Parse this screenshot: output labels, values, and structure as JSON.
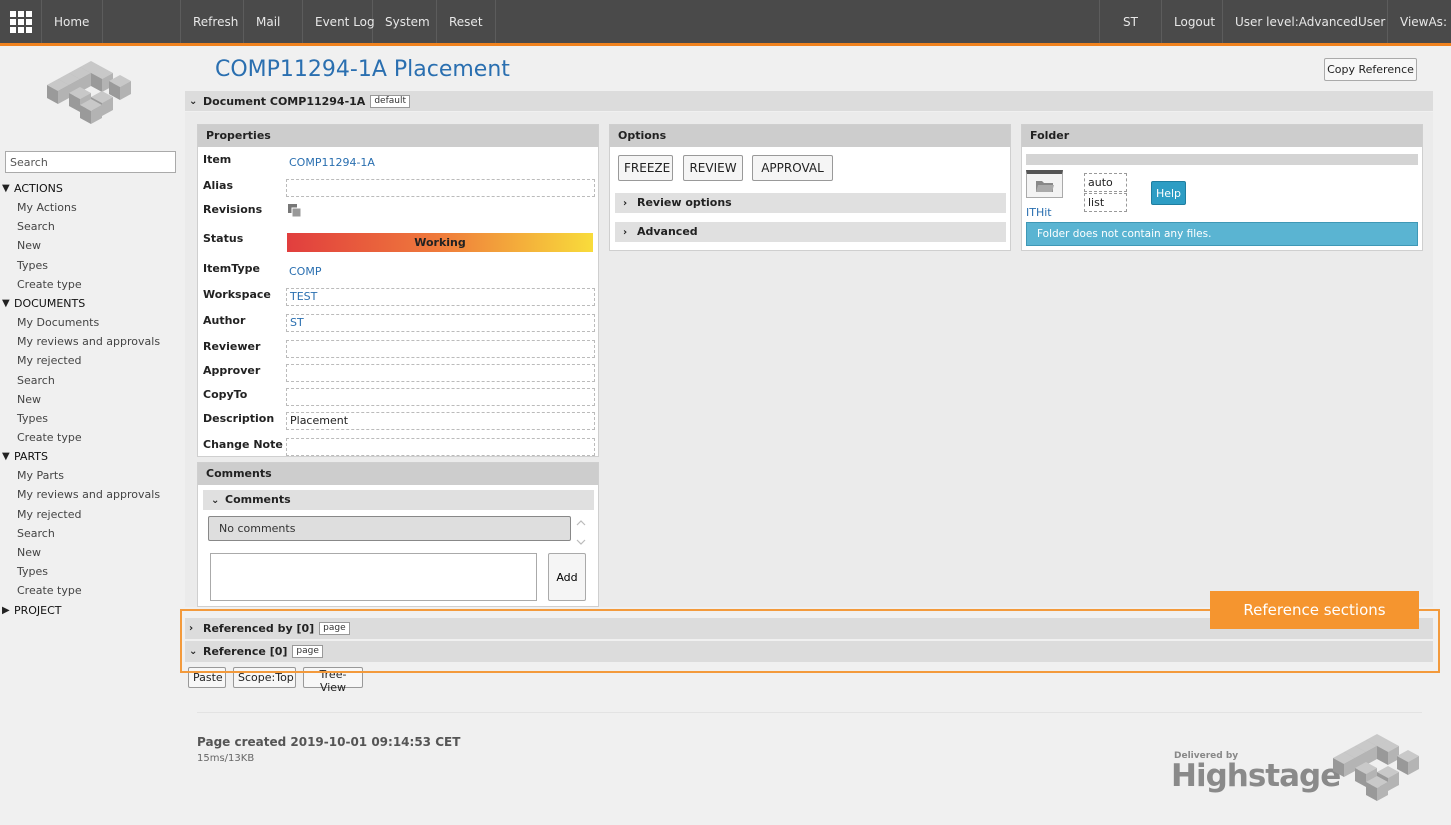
{
  "topbar": {
    "items_left": [
      "Home",
      "Refresh",
      "Mail",
      "Event Log",
      "System",
      "Reset"
    ],
    "user": "ST",
    "logout": "Logout",
    "user_level": "User level:AdvancedUser",
    "view_as": "ViewAs:"
  },
  "sidebar": {
    "search_placeholder": "Search",
    "groups": [
      {
        "label": "ACTIONS",
        "expanded": true,
        "items": [
          "My Actions",
          "Search",
          "New",
          "Types",
          "Create type"
        ]
      },
      {
        "label": "DOCUMENTS",
        "expanded": true,
        "items": [
          "My Documents",
          "My reviews and approvals",
          "My rejected",
          "Search",
          "New",
          "Types",
          "Create type"
        ]
      },
      {
        "label": "PARTS",
        "expanded": true,
        "items": [
          "My Parts",
          "My reviews and approvals",
          "My rejected",
          "Search",
          "New",
          "Types",
          "Create type"
        ]
      },
      {
        "label": "PROJECT",
        "expanded": false,
        "items": []
      }
    ]
  },
  "header": {
    "title": "COMP11294-1A Placement",
    "copy_reference": "Copy Reference"
  },
  "document_bar": {
    "label": "Document COMP11294-1A",
    "tag": "default"
  },
  "properties": {
    "title": "Properties",
    "rows": [
      {
        "label": "Item",
        "value": "COMP11294-1A"
      },
      {
        "label": "Alias",
        "value": ""
      },
      {
        "label": "Revisions",
        "value": ""
      },
      {
        "label": "Status",
        "value": "Working"
      },
      {
        "label": "ItemType",
        "value": "COMP"
      },
      {
        "label": "Workspace",
        "value": "TEST"
      },
      {
        "label": "Author",
        "value": "ST"
      },
      {
        "label": "Reviewer",
        "value": ""
      },
      {
        "label": "Approver",
        "value": ""
      },
      {
        "label": "CopyTo",
        "value": ""
      },
      {
        "label": "Description",
        "value": "Placement"
      },
      {
        "label": "Change Note",
        "value": ""
      }
    ]
  },
  "comments": {
    "title": "Comments",
    "sub_title": "Comments",
    "no_comments": "No comments",
    "add_button": "Add"
  },
  "options": {
    "title": "Options",
    "buttons": [
      "FREEZE",
      "REVIEW",
      "APPROVAL"
    ],
    "sections": [
      "Review options",
      "Advanced"
    ]
  },
  "folder": {
    "title": "Folder",
    "folder_name": "ITHit",
    "choices": [
      "auto",
      "list"
    ],
    "help": "Help",
    "info": "Folder does not contain any files."
  },
  "references": {
    "referenced_by": "Referenced by [0]",
    "referenced_by_tag": "page",
    "reference": "Reference [0]",
    "reference_tag": "page",
    "buttons": [
      "Paste",
      "Scope:Top",
      "Tree-View"
    ]
  },
  "annotation": {
    "callout": "Reference sections"
  },
  "footer": {
    "created": "Page created 2019-10-01 09:14:53 CET",
    "timing": "15ms/13KB",
    "delivered_by": "Delivered by",
    "brand": "Highstage"
  },
  "colors": {
    "accent_orange": "#f0821e",
    "link_blue": "#2a6fb0",
    "info_teal": "#5ab4d2",
    "help_button": "#2d9dc4"
  }
}
